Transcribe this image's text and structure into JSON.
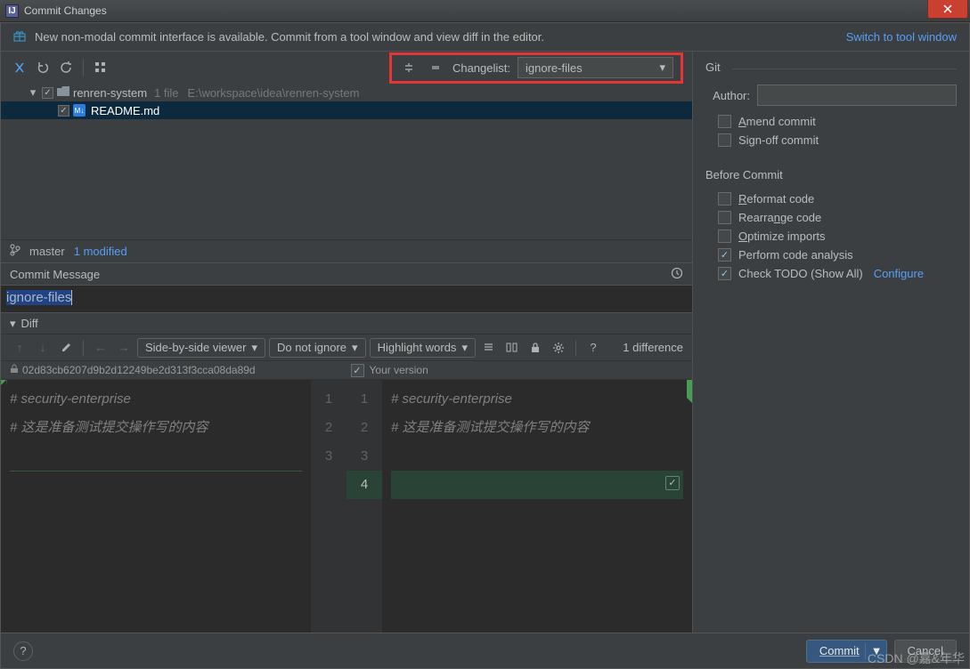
{
  "window": {
    "title": "Commit Changes"
  },
  "banner": {
    "message": "New non-modal commit interface is available. Commit from a tool window and view diff in the editor.",
    "switch_link": "Switch to tool window"
  },
  "toolbar": {
    "changelist_label": "Changelist:",
    "changelist_value": "ignore-files"
  },
  "tree": {
    "project": "renren-system",
    "file_count": "1 file",
    "project_path": "E:\\workspace\\idea\\renren-system",
    "file": "README.md"
  },
  "branch": {
    "name": "master",
    "modified": "1 modified"
  },
  "commit_message": {
    "label": "Commit Message",
    "value": "ignore-files"
  },
  "diff": {
    "section": "Diff",
    "viewer": "Side-by-side viewer",
    "ignore": "Do not ignore",
    "highlight": "Highlight words",
    "count": "1 difference",
    "base_hash": "02d83cb6207d9b2d12249be2d313f3cca08da89d",
    "your_version": "Your version",
    "lines_left": [
      "# security-enterprise",
      "# 这是准备测试提交操作写的内容"
    ],
    "lines_right": [
      "# security-enterprise",
      "# 这是准备测试提交操作写的内容",
      "",
      ""
    ],
    "gutter": [
      {
        "l": "1",
        "r": "1"
      },
      {
        "l": "2",
        "r": "2"
      },
      {
        "l": "3",
        "r": "3"
      },
      {
        "l": "",
        "r": "4",
        "added": true
      }
    ]
  },
  "git": {
    "section": "Git",
    "author_label": "Author:",
    "author_value": "",
    "amend": "Amend commit",
    "signoff": "Sign-off commit"
  },
  "before_commit": {
    "section": "Before Commit",
    "reformat": "Reformat code",
    "rearrange": "Rearrange code",
    "optimize": "Optimize imports",
    "analysis": "Perform code analysis",
    "todo": "Check TODO (Show All)",
    "configure": "Configure"
  },
  "footer": {
    "commit": "Commit",
    "cancel": "Cancel"
  },
  "watermark": "CSDN @嘉&年华"
}
